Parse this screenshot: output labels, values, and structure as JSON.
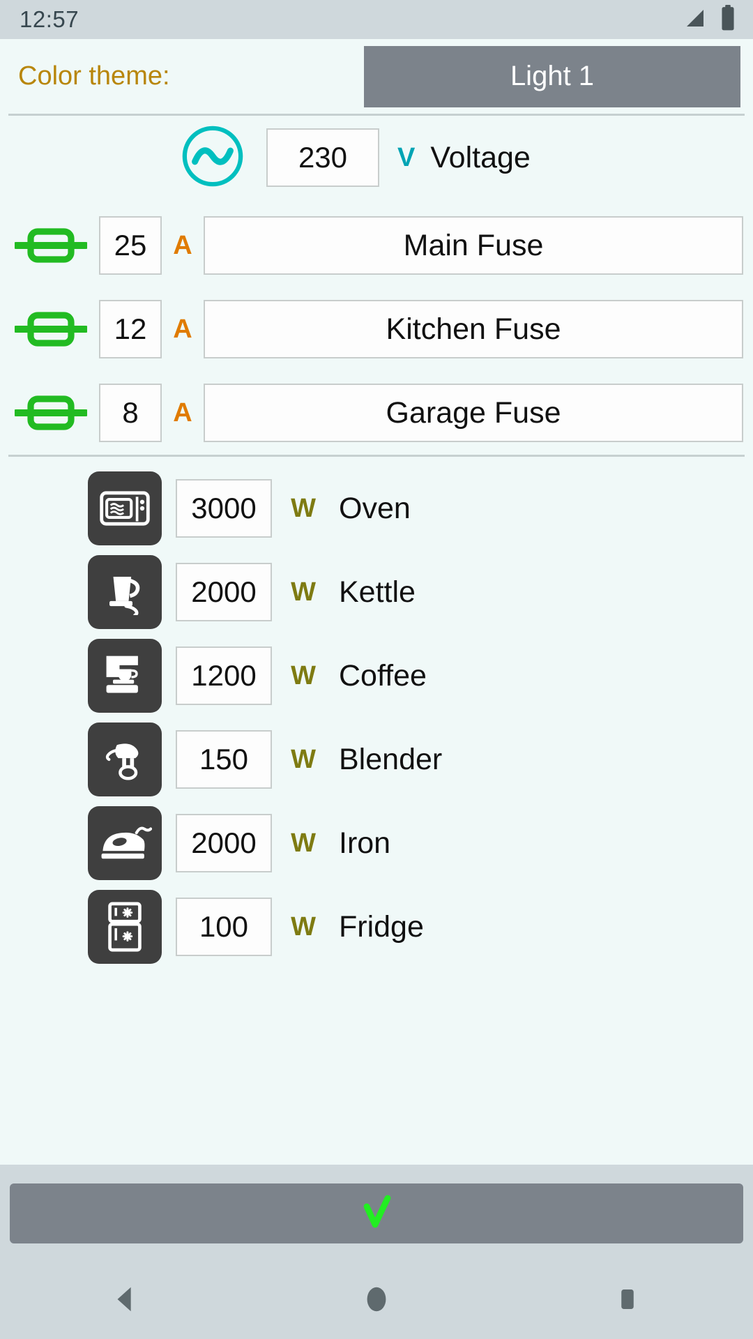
{
  "statusbar": {
    "time": "12:57",
    "signal_icon": "no-signal-icon",
    "battery_icon": "battery-full-icon"
  },
  "theme": {
    "label": "Color theme:",
    "selected": "Light 1"
  },
  "voltage": {
    "icon": "ac-source-icon",
    "value": "230",
    "unit": "V",
    "name": "Voltage",
    "unit_color": "#00A4B4"
  },
  "fuses": {
    "unit": "A",
    "unit_color": "#E07B00",
    "icon": "fuse-icon",
    "icon_color": "#22BB22",
    "items": [
      {
        "amps": "25",
        "name": "Main Fuse"
      },
      {
        "amps": "12",
        "name": "Kitchen Fuse"
      },
      {
        "amps": "8",
        "name": "Garage Fuse"
      }
    ]
  },
  "appliances": {
    "unit": "W",
    "unit_color": "#7E7B12",
    "items": [
      {
        "icon": "oven-icon",
        "watts": "3000",
        "name": "Oven"
      },
      {
        "icon": "kettle-icon",
        "watts": "2000",
        "name": "Kettle"
      },
      {
        "icon": "coffee-machine-icon",
        "watts": "1200",
        "name": "Coffee"
      },
      {
        "icon": "blender-icon",
        "watts": "150",
        "name": "Blender"
      },
      {
        "icon": "iron-icon",
        "watts": "2000",
        "name": "Iron"
      },
      {
        "icon": "fridge-icon",
        "watts": "100",
        "name": "Fridge"
      }
    ]
  },
  "confirm": {
    "icon": "checkmark-icon",
    "color": "#22EE22"
  },
  "navbar": {
    "back": "back-triangle-icon",
    "home": "home-circle-icon",
    "recents": "recents-square-icon"
  },
  "colors": {
    "background": "#F0F9F8",
    "statusbar": "#CFD8DC",
    "button": "#7C838B",
    "accent_label": "#B8860B"
  }
}
